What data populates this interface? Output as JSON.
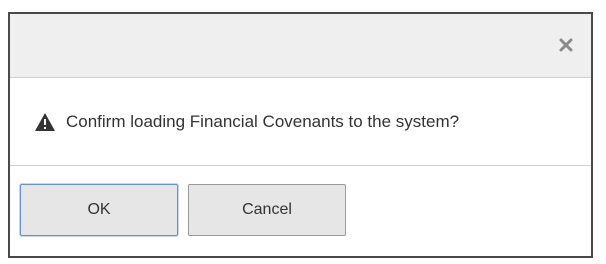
{
  "dialog": {
    "close_icon": "close-icon",
    "warning_icon": "warning-triangle-icon",
    "message": "Confirm loading Financial Covenants to the system?",
    "buttons": {
      "ok_label": "OK",
      "cancel_label": "Cancel"
    }
  },
  "colors": {
    "titlebar_bg": "#efefef",
    "button_bg": "#e6e6e6",
    "focus_border": "#6b8fd6",
    "text": "#333333"
  }
}
